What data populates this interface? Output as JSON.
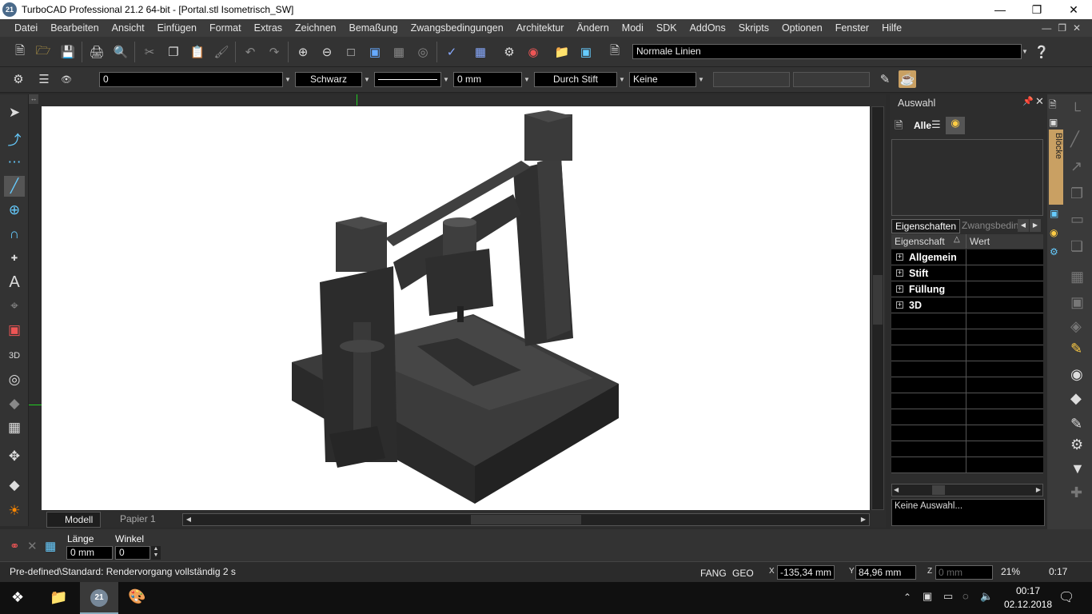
{
  "window": {
    "title": "TurboCAD Professional 21.2 64-bit - [Portal.stl Isometrisch_SW]",
    "app_icon": "21"
  },
  "menu": [
    "Datei",
    "Bearbeiten",
    "Ansicht",
    "Einfügen",
    "Format",
    "Extras",
    "Zeichnen",
    "Bemaßung",
    "Zwangsbedingungen",
    "Architektur",
    "Ändern",
    "Modi",
    "SDK",
    "AddOns",
    "Skripts",
    "Optionen",
    "Fenster",
    "Hilfe"
  ],
  "toolbar1": {
    "linestyle_value": "Normale Linien"
  },
  "toolbar2": {
    "layer_value": "0",
    "color_value": "Schwarz",
    "width_value": "0 mm",
    "pen_value": "Durch Stift",
    "fill_value": "Keine"
  },
  "panel": {
    "title": "Auswahl",
    "filter_all": "Alle",
    "side_tab": "Blöcke",
    "tabs": [
      "Eigenschaften",
      "Zwangsbeding"
    ],
    "columns": [
      "Eigenschaft",
      "Wert"
    ],
    "groups": [
      "Allgemein",
      "Stift",
      "Füllung",
      "3D"
    ],
    "selection_status": "Keine Auswahl..."
  },
  "view_tabs": [
    "Modell",
    "Papier 1"
  ],
  "input": {
    "length_label": "Länge",
    "length_value": "0 mm",
    "angle_label": "Winkel",
    "angle_value": "0"
  },
  "status": {
    "message": "Pre-defined\\Standard: Rendervorgang vollständig 2 s",
    "fang": "FANG",
    "geo": "GEO",
    "x": "-135,34 mm",
    "y": "84,96 mm",
    "z": "0 mm",
    "zoom": "21%",
    "time": "0:17"
  },
  "taskbar": {
    "clock": "00:17",
    "date": "02.12.2018"
  }
}
